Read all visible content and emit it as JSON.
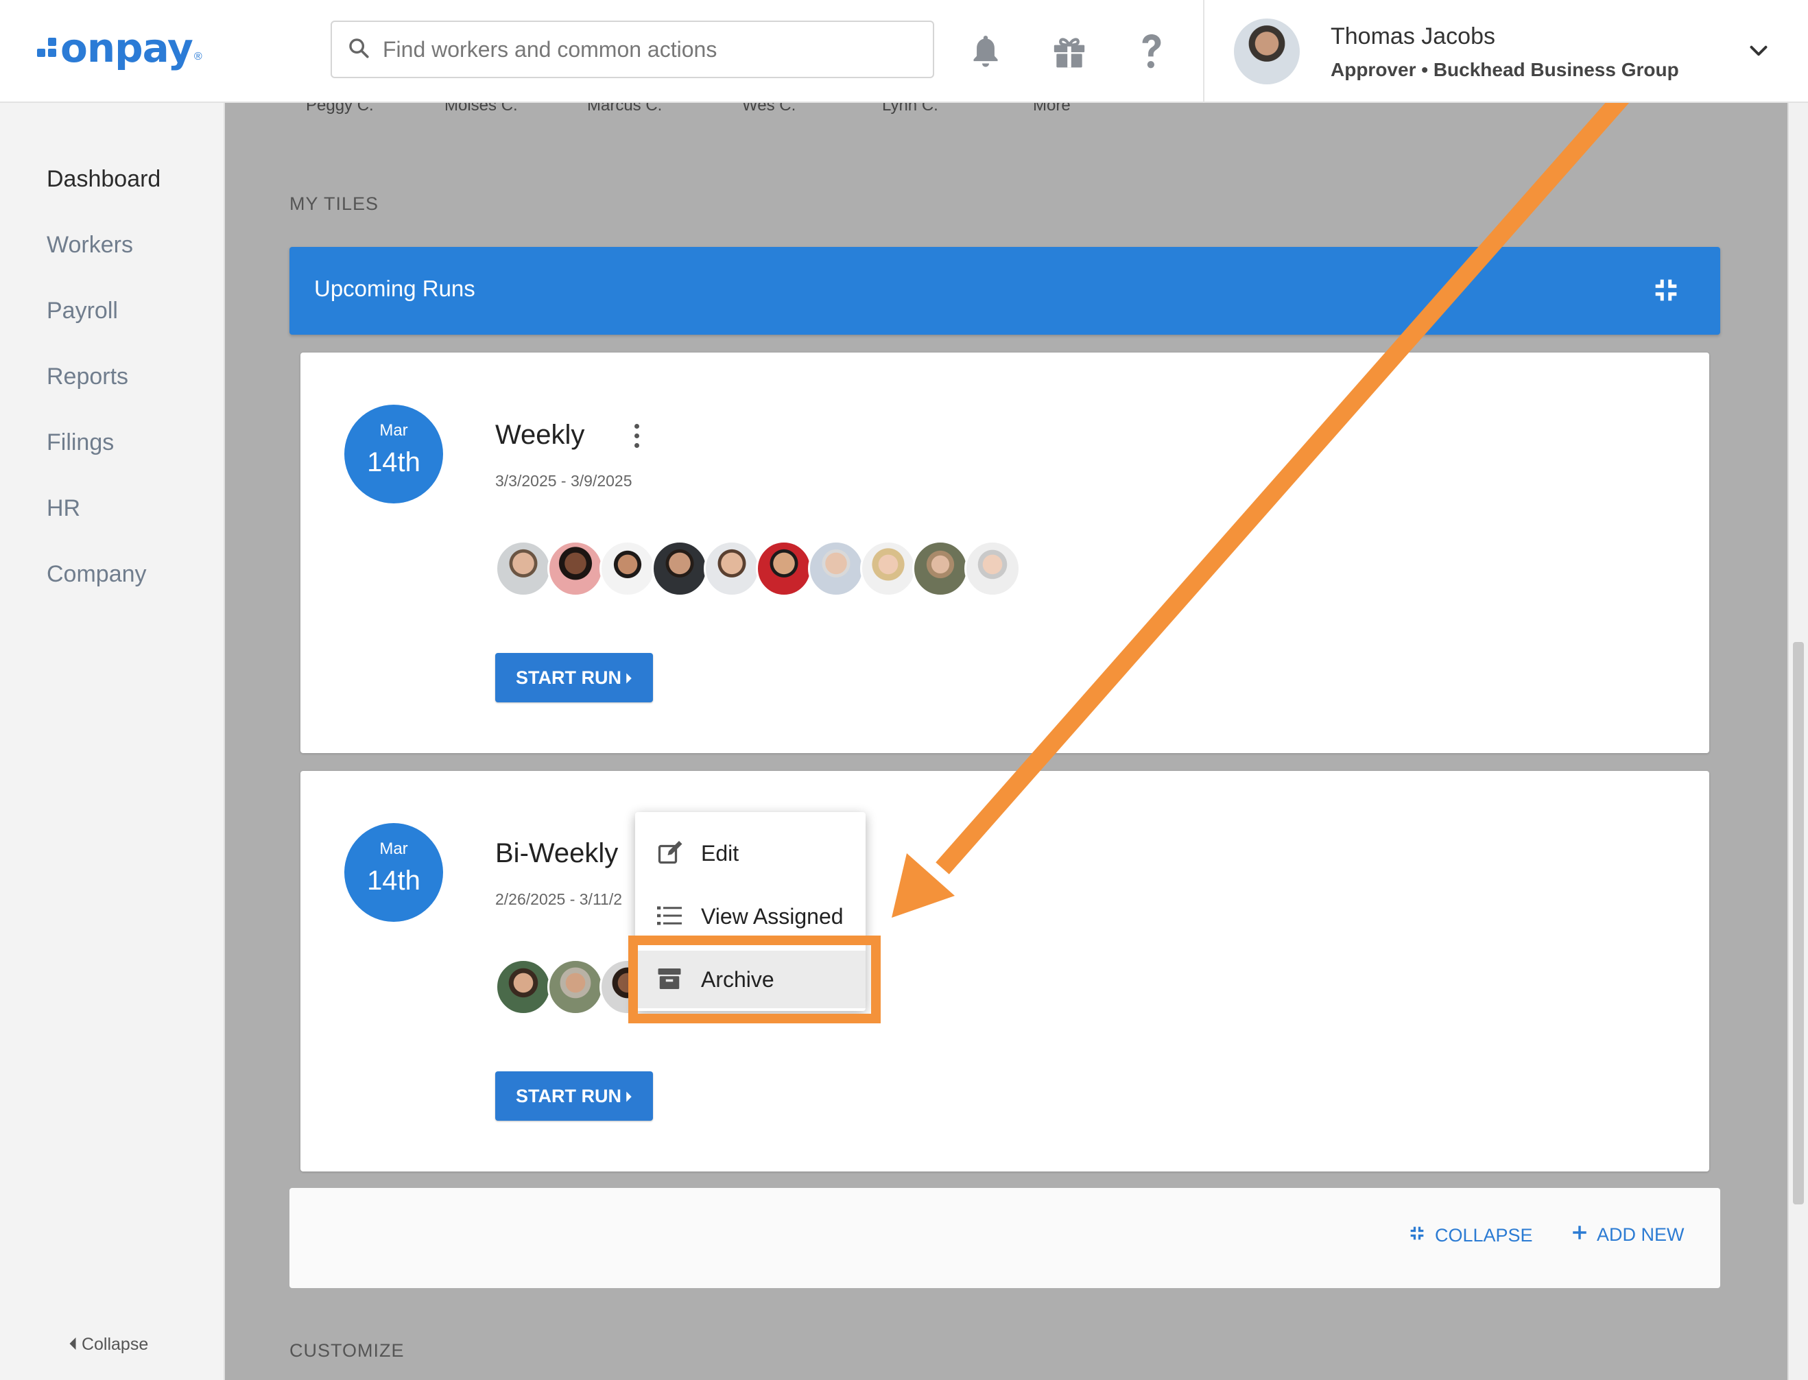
{
  "app": {
    "logo_text": "onpay",
    "logo_reg": "®"
  },
  "search": {
    "placeholder": "Find workers and common actions"
  },
  "topbar_icons": [
    "bell-icon",
    "gift-icon",
    "help-icon"
  ],
  "user": {
    "name": "Thomas Jacobs",
    "role": "Approver • Buckhead Business Group"
  },
  "sidebar": {
    "items": [
      {
        "label": "Dashboard",
        "active": true
      },
      {
        "label": "Workers",
        "active": false
      },
      {
        "label": "Payroll",
        "active": false
      },
      {
        "label": "Reports",
        "active": false
      },
      {
        "label": "Filings",
        "active": false
      },
      {
        "label": "HR",
        "active": false
      },
      {
        "label": "Company",
        "active": false
      }
    ],
    "collapse_label": "Collapse"
  },
  "peek_names": [
    "Peggy C.",
    "Moises C.",
    "Marcus C.",
    "Wes C.",
    "Lynn C.",
    "More"
  ],
  "sections": {
    "my_tiles": "MY TILES",
    "customize": "CUSTOMIZE"
  },
  "tile": {
    "title": "Upcoming Runs"
  },
  "runs": [
    {
      "month": "Mar",
      "day": "14th",
      "name": "Weekly",
      "dates": "3/3/2025 - 3/9/2025",
      "button": "START RUN"
    },
    {
      "month": "Mar",
      "day": "14th",
      "name": "Bi-Weekly",
      "dates": "2/26/2025 - 3/11/2",
      "button": "START RUN"
    }
  ],
  "menu": {
    "items": [
      {
        "label": "Edit"
      },
      {
        "label": "View Assigned"
      },
      {
        "label": "Archive"
      }
    ]
  },
  "footer": {
    "collapse_label": "COLLAPSE",
    "add_new_label": "ADD NEW"
  },
  "colors": {
    "brand": "#2b7bd6",
    "tile_header": "#2880d9",
    "highlight": "#f4923a",
    "overlay": "#aeaeae"
  }
}
